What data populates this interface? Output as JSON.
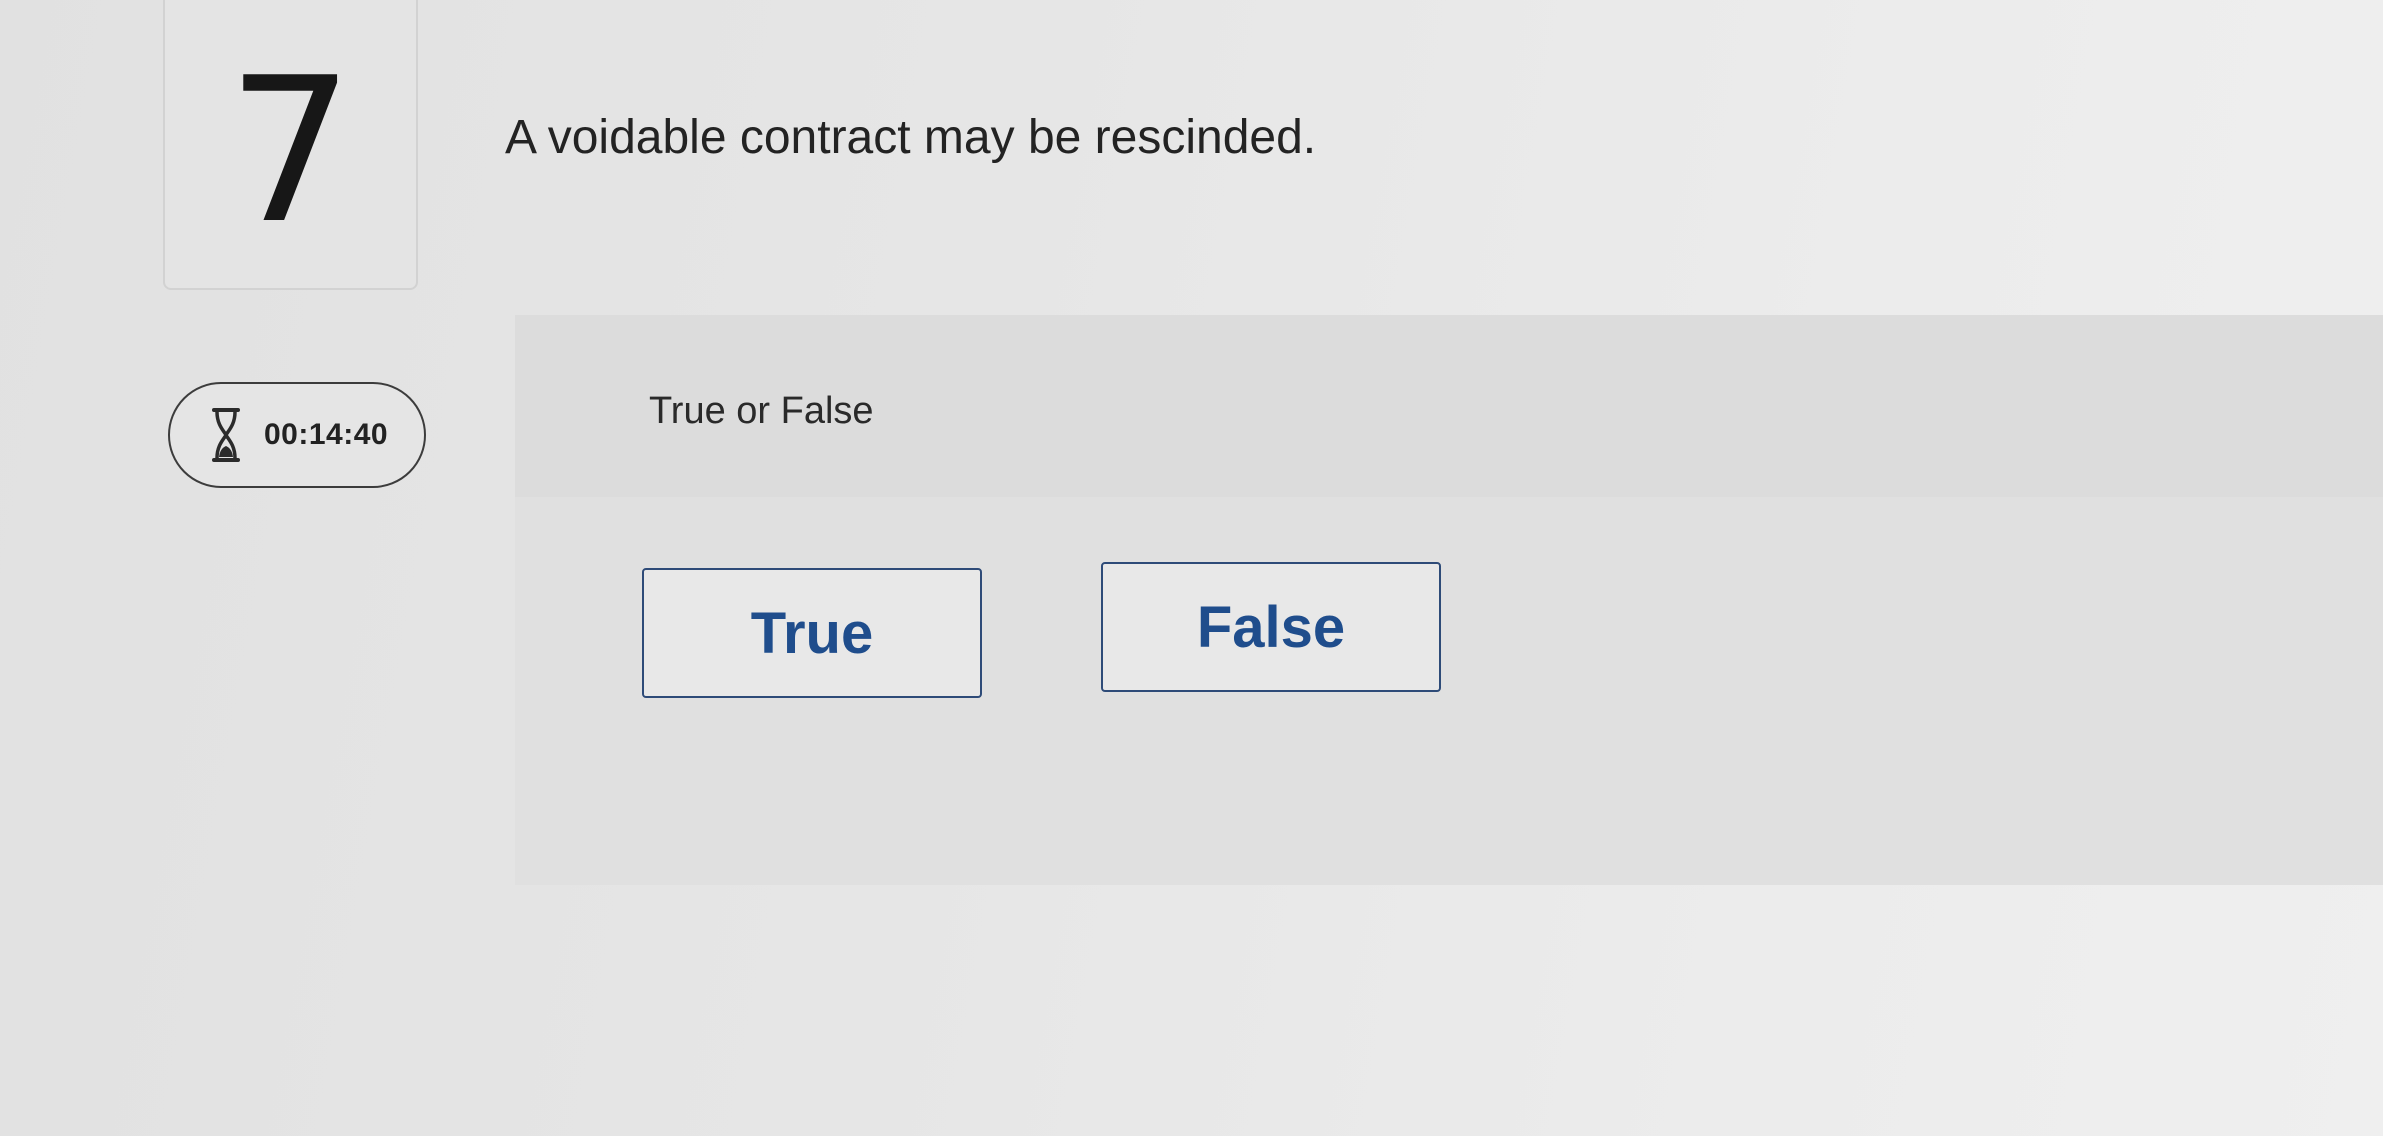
{
  "question": {
    "number": "7",
    "text": "A voidable contract may be rescinded."
  },
  "timer": {
    "icon": "hourglass-icon",
    "value": "00:14:40"
  },
  "answer_section": {
    "instruction": "True or False",
    "options": [
      {
        "label": "True"
      },
      {
        "label": "False"
      }
    ]
  },
  "colors": {
    "button_text": "#1f4d8c",
    "button_border": "#2e4b78",
    "panel_background": "#dcdcdc"
  }
}
